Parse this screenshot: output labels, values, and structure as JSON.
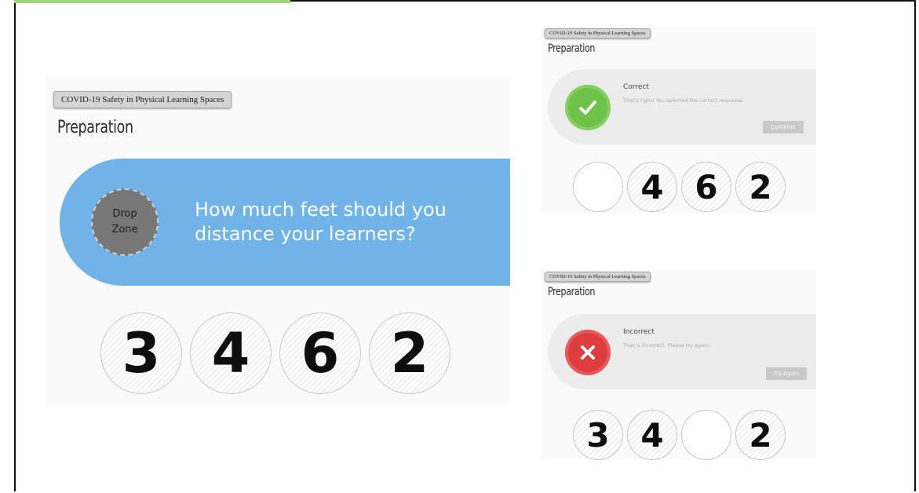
{
  "main_slide": {
    "course_tag": "COVID-19 Safety in Physical Learning Spaces",
    "title": "Preparation",
    "drop_zone": {
      "line1": "Drop",
      "line2": "Zone"
    },
    "question": "How much feet should you distance your learners?",
    "options": [
      "3",
      "4",
      "6",
      "2"
    ]
  },
  "correct_slide": {
    "course_tag": "COVID-19 Safety in Physical Learning Spaces",
    "title": "Preparation",
    "feedback": {
      "icon": "checkmark-icon",
      "heading": "Correct",
      "message": "That's right! You selected the correct response.",
      "button": "Continue",
      "color": "#6dc247"
    },
    "options": [
      "",
      "4",
      "6",
      "2"
    ]
  },
  "incorrect_slide": {
    "course_tag": "COVID-19 Safety in Physical Learning Spaces",
    "title": "Preparation",
    "feedback": {
      "icon": "x-mark-icon",
      "heading": "Incorrect",
      "message": "That is incorrect. Please try again.",
      "button": "Try Again",
      "color": "#de3d3d"
    },
    "options": [
      "3",
      "4",
      "",
      "2"
    ]
  },
  "colors": {
    "banner": "#6fb3e8",
    "accent": "#9fd27a"
  }
}
